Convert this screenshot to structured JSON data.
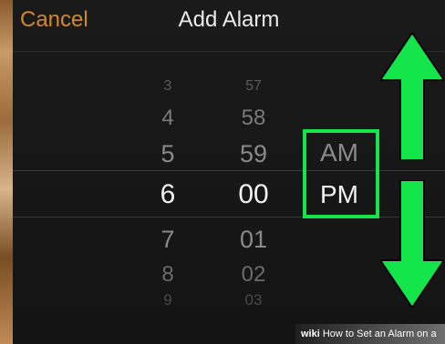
{
  "navbar": {
    "cancel_label": "Cancel",
    "title": "Add Alarm"
  },
  "picker": {
    "hours": [
      "3",
      "4",
      "5",
      "6",
      "7",
      "8",
      "9"
    ],
    "minutes": [
      "57",
      "58",
      "59",
      "00",
      "01",
      "02",
      "03"
    ],
    "selected_hour": "6",
    "selected_minute": "00",
    "period_options": [
      "AM",
      "PM"
    ],
    "selected_period": "PM"
  },
  "overlay": {
    "arrow_color": "#13e54b",
    "banner": {
      "brand": "wiki",
      "text": "How to Set an Alarm on a"
    }
  },
  "colors": {
    "cancel": "#d08a2a",
    "highlight": "#13e54b"
  }
}
